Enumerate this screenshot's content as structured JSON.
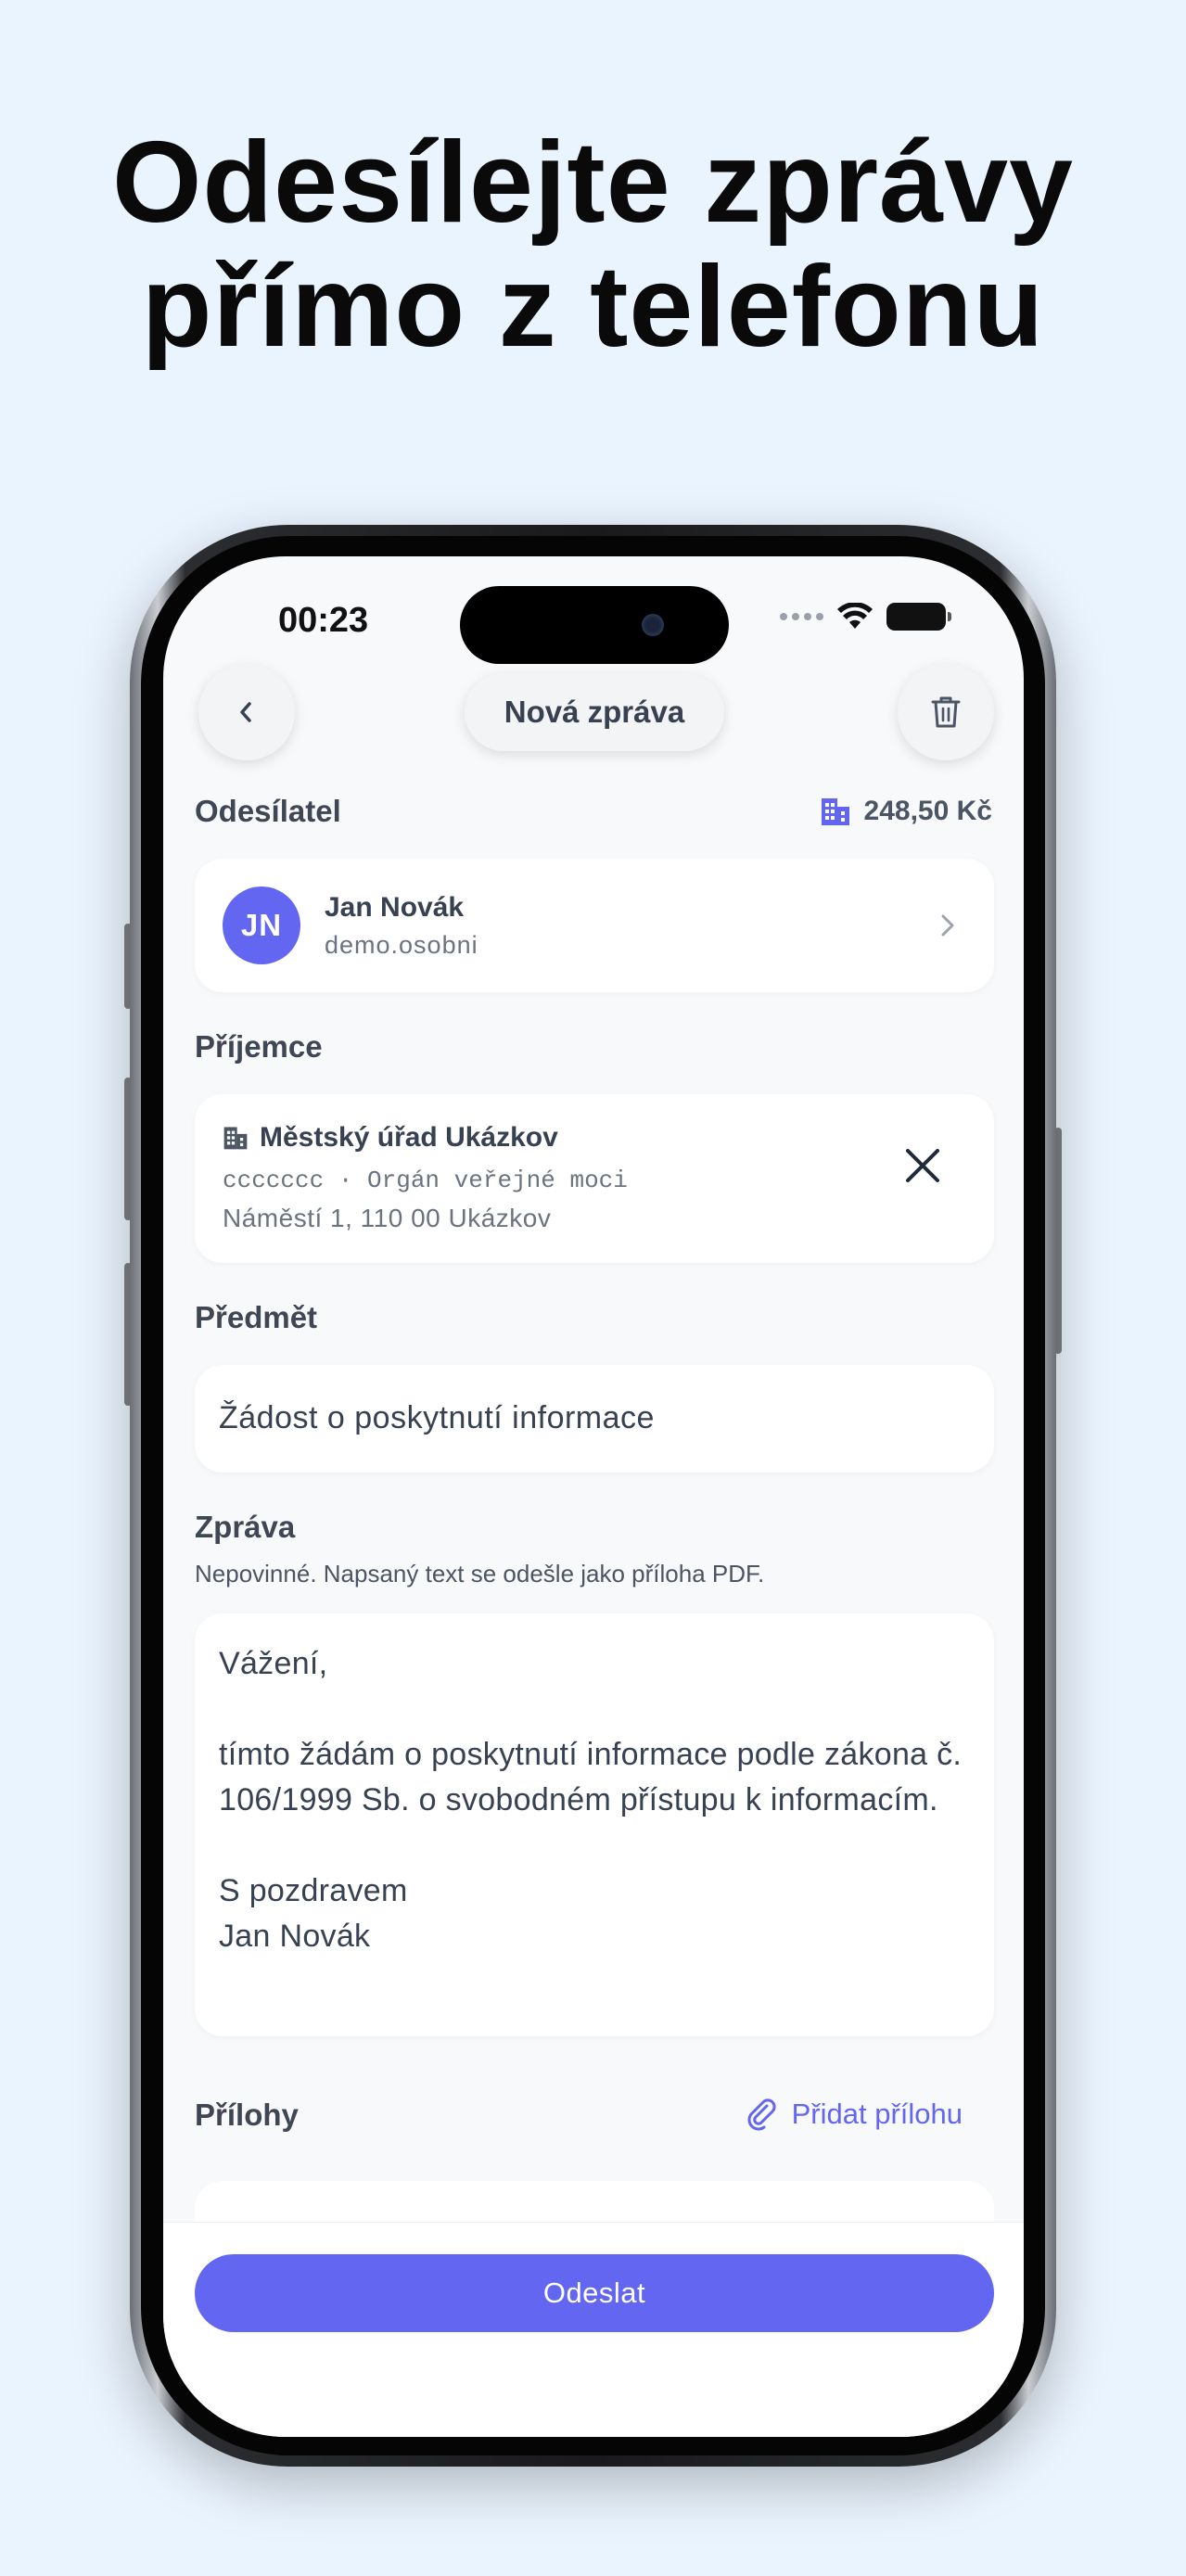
{
  "headline": {
    "line1": "Odesílejte zprávy",
    "line2": "přímo z telefonu"
  },
  "status_bar": {
    "time": "00:23"
  },
  "nav": {
    "title": "Nová zpráva",
    "back_icon": "chevron-left-icon",
    "delete_icon": "trash-icon"
  },
  "sender": {
    "label": "Odesílatel",
    "credit": "248,50 Kč",
    "credit_icon": "building-icon",
    "initials": "JN",
    "name": "Jan Novák",
    "id": "demo.osobni"
  },
  "recipient": {
    "label": "Příjemce",
    "name": "Městský úřad Ukázkov",
    "meta": "ccccccc · Orgán veřejné moci",
    "address": "Náměstí 1, 110 00 Ukázkov"
  },
  "subject": {
    "label": "Předmět",
    "value": "Žádost o poskytnutí informace"
  },
  "message": {
    "label": "Zpráva",
    "hint": "Nepovinné. Napsaný text se odešle jako příloha PDF.",
    "body": "Vážení,\n\ntímto žádám o poskytnutí informace podle zákona č. 106/1999 Sb. o svobodném přístupu k informacím.\n\nS pozdravem\nJan Novák"
  },
  "attachments": {
    "label": "Přílohy",
    "add_label": "Přidat přílohu"
  },
  "send": {
    "label": "Odeslat"
  },
  "colors": {
    "accent": "#6366f1",
    "background": "#eaf4fe",
    "screen": "#f8f9fb"
  }
}
